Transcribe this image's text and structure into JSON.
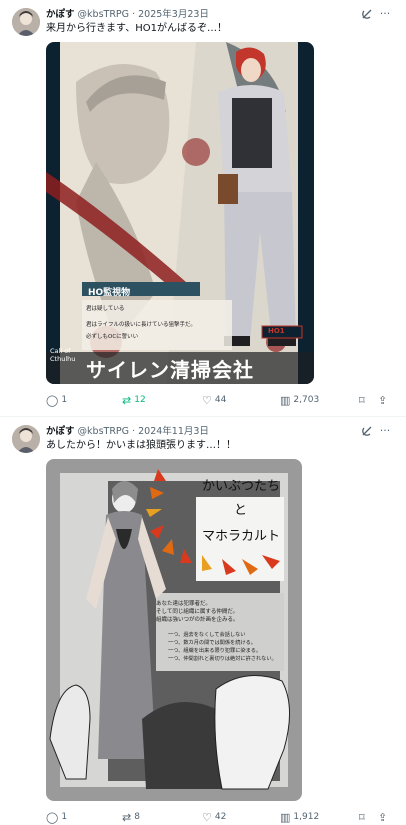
{
  "posts": [
    {
      "username": "かぽす",
      "handle": "@kbsTRPG",
      "date": "2025年3月23日",
      "text": "来月から行きます、HO1がんばるぞ…！",
      "image_text": {
        "ho_label": "HO監視物",
        "line1": "君は疑している",
        "line2": "君はライフルの扱いに長けている狙撃手だ。",
        "line3": "必ずしもOCに誓いい",
        "game": "Call of Cthulhu",
        "title": "サイレン清掃会社",
        "stamp": "HO1"
      },
      "reply_count": "1",
      "repost_count": "12",
      "like_count": "44",
      "view_count": "2,703"
    },
    {
      "username": "かぽす",
      "handle": "@kbsTRPG",
      "date": "2024年11月3日",
      "text": "あしたから！かいまは狼頭張ります…！！",
      "image_text": {
        "title_line1": "かいぶつたち",
        "title_line2": "と",
        "title_line3": "マホラカルト",
        "intro1": "あなた達は犯罪者だ。",
        "intro2": "そして同じ組織に属する仲間だ。",
        "intro3": "組織は強いつがの計画を企みる。",
        "rule1": "一つ、過去をなくして会話しない",
        "rule2": "一つ、数カ月の間では関係を続ける。",
        "rule3": "一つ、組織を出来る限り犯罪に染まる。",
        "rule4": "一つ、仲間割れと裏切りは絶対に許されない。"
      },
      "reply_count": "1",
      "repost_count": "8",
      "like_count": "42",
      "view_count": "1,912"
    }
  ],
  "icons": {
    "grok": "grok-icon",
    "more": "more-icon",
    "reply": "reply-icon",
    "repost": "repost-icon",
    "like": "heart-icon",
    "views": "views-icon",
    "bookmark": "bookmark-icon",
    "share": "share-icon"
  },
  "colors": {
    "repost_active": "#00ba7c",
    "secondary_text": "#536471",
    "divider": "#eff3f4"
  }
}
